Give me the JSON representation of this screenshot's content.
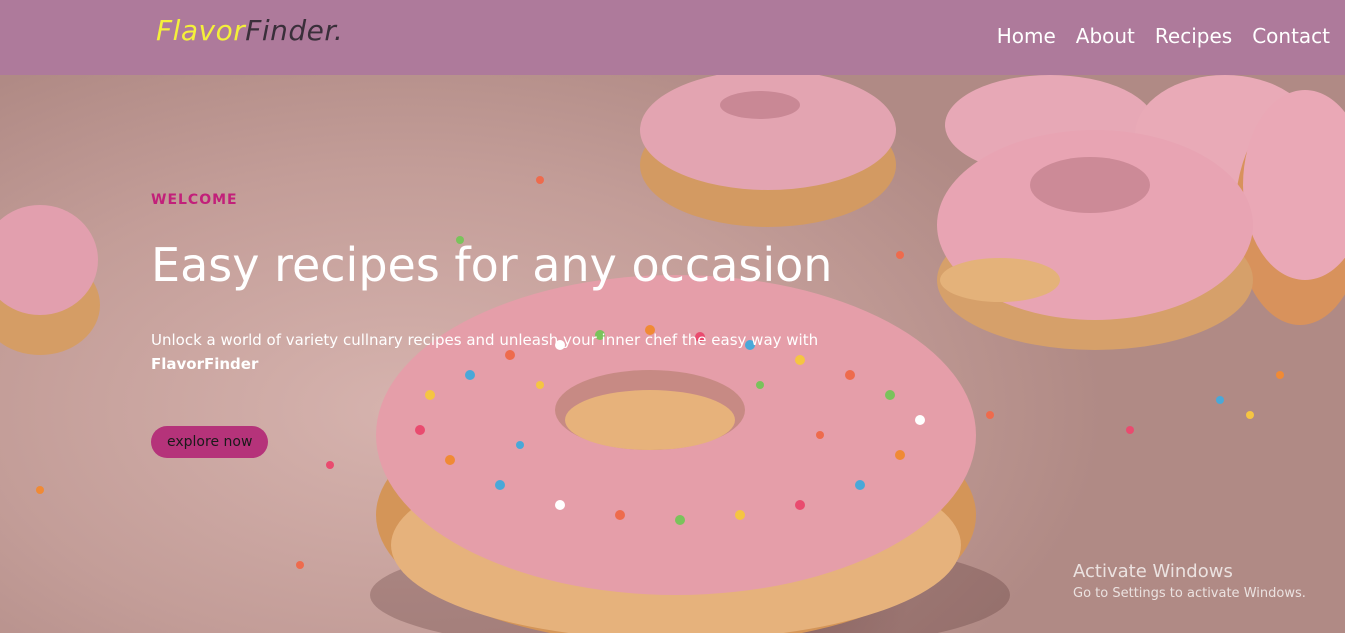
{
  "brand": {
    "part1": "Flavor",
    "part2": "Finder."
  },
  "nav": {
    "items": [
      "Home",
      "About",
      "Recipes",
      "Contact"
    ]
  },
  "hero": {
    "eyebrow": "WELCOME",
    "headline": "Easy recipes for any occasion",
    "subtext": "Unlock a world of variety cullnary recipes and unleash your inner chef the easy way with",
    "subtext_brand": "FlavorFinder",
    "cta_label": "explore now"
  },
  "watermark": {
    "title": "Activate Windows",
    "subtitle": "Go to Settings to activate Windows."
  },
  "colors": {
    "navbar_bg": "#ae7a9b",
    "logo_accent": "#f4f03a",
    "logo_dark": "#3a2f3a",
    "eyebrow": "#c2207a",
    "cta_bg": "#b5337a"
  }
}
